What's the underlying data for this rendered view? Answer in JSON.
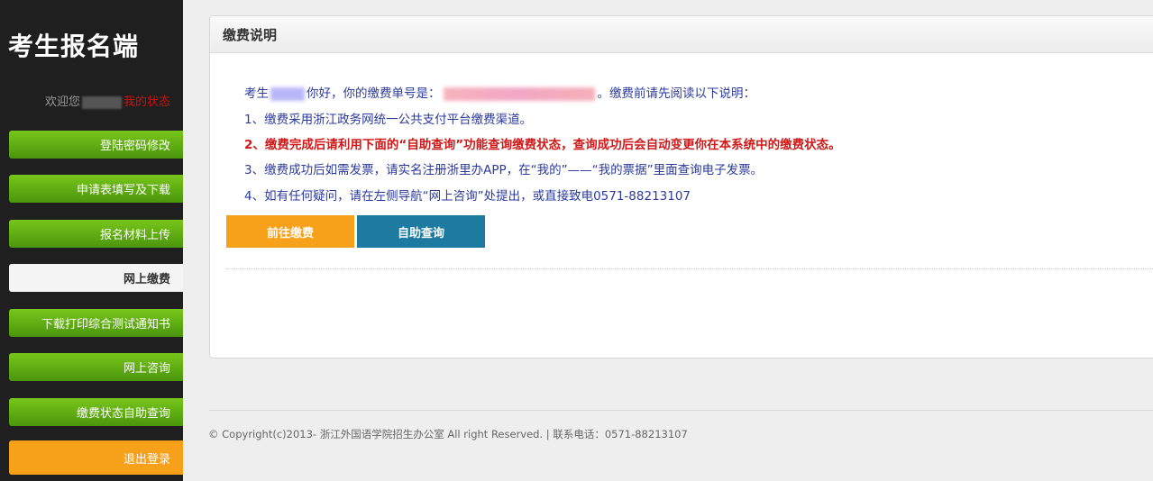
{
  "sidebar": {
    "title": "考生报名端",
    "welcome": "欢迎您",
    "status_link": "我的状态",
    "items": [
      {
        "label": "登陆密码修改"
      },
      {
        "label": "申请表填写及下载"
      },
      {
        "label": "报名材料上传"
      },
      {
        "label": "网上缴费"
      },
      {
        "label": "下载打印综合测试通知书"
      },
      {
        "label": "网上咨询"
      },
      {
        "label": "缴费状态自助查询"
      },
      {
        "label": "退出登录"
      }
    ]
  },
  "panel": {
    "title": "缴费说明",
    "intro_prefix": "考生",
    "intro_mid": "你好，你的缴费单号是：",
    "intro_suffix": "。缴费前请先阅读以下说明：",
    "line1": "1、缴费采用浙江政务网统一公共支付平台缴费渠道。",
    "line2": "2、缴费完成后请利用下面的“自助查询”功能查询缴费状态，查询成功后会自动变更你在本系统中的缴费状态。",
    "line3": "3、缴费成功后如需发票，请实名注册浙里办APP，在“我的”——“我的票据”里面查询电子发票。",
    "line4": "4、如有任何疑问，请在左侧导航“网上咨询”处提出，或直接致电0571-88213107",
    "btn_pay": "前往缴费",
    "btn_query": "自助查询"
  },
  "footer": {
    "text": "© Copyright(c)2013- 浙江外国语学院招生办公室 All right Reserved. | 联系电话：0571-88213107"
  },
  "colors": {
    "sidebar_bg": "#1f1f1f",
    "nav_green": "#5aa812",
    "accent_orange": "#f7a01a",
    "accent_blue": "#1e7ba0",
    "text_blue": "#2b3a9c",
    "text_red": "#d01818"
  }
}
